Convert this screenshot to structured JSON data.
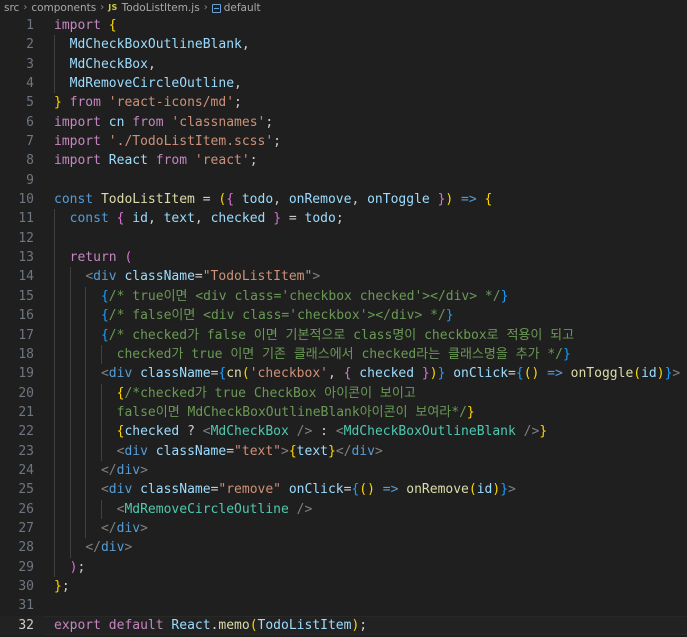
{
  "breadcrumb": {
    "items": [
      "src",
      "components",
      "TodoListItem.js",
      "default"
    ],
    "file_badge": "JS"
  },
  "editor": {
    "active_line": 32,
    "lines": [
      {
        "n": 1,
        "indent": 0,
        "tokens": [
          [
            "k",
            "import"
          ],
          [
            "w",
            " "
          ],
          [
            "b1",
            "{"
          ]
        ]
      },
      {
        "n": 2,
        "indent": 1,
        "tokens": [
          [
            "v",
            "MdCheckBoxOutlineBlank"
          ],
          [
            "w",
            ","
          ]
        ]
      },
      {
        "n": 3,
        "indent": 1,
        "tokens": [
          [
            "v",
            "MdCheckBox"
          ],
          [
            "w",
            ","
          ]
        ]
      },
      {
        "n": 4,
        "indent": 1,
        "tokens": [
          [
            "v",
            "MdRemoveCircleOutline"
          ],
          [
            "w",
            ","
          ]
        ]
      },
      {
        "n": 5,
        "indent": 0,
        "tokens": [
          [
            "b1",
            "}"
          ],
          [
            "w",
            " "
          ],
          [
            "k",
            "from"
          ],
          [
            "w",
            " "
          ],
          [
            "s",
            "'react-icons/md'"
          ],
          [
            "w",
            ";"
          ]
        ]
      },
      {
        "n": 6,
        "indent": 0,
        "tokens": [
          [
            "k",
            "import"
          ],
          [
            "w",
            " "
          ],
          [
            "v",
            "cn"
          ],
          [
            "w",
            " "
          ],
          [
            "k",
            "from"
          ],
          [
            "w",
            " "
          ],
          [
            "s",
            "'classnames'"
          ],
          [
            "w",
            ";"
          ]
        ]
      },
      {
        "n": 7,
        "indent": 0,
        "tokens": [
          [
            "k",
            "import"
          ],
          [
            "w",
            " "
          ],
          [
            "s",
            "'./TodoListItem.scss'"
          ],
          [
            "w",
            ";"
          ]
        ]
      },
      {
        "n": 8,
        "indent": 0,
        "tokens": [
          [
            "k",
            "import"
          ],
          [
            "w",
            " "
          ],
          [
            "v",
            "React"
          ],
          [
            "w",
            " "
          ],
          [
            "k",
            "from"
          ],
          [
            "w",
            " "
          ],
          [
            "s",
            "'react'"
          ],
          [
            "w",
            ";"
          ]
        ]
      },
      {
        "n": 9,
        "indent": 0,
        "tokens": []
      },
      {
        "n": 10,
        "indent": 0,
        "tokens": [
          [
            "d",
            "const"
          ],
          [
            "w",
            " "
          ],
          [
            "f",
            "TodoListItem"
          ],
          [
            "w",
            " = "
          ],
          [
            "b1",
            "("
          ],
          [
            "b2",
            "{"
          ],
          [
            "w",
            " "
          ],
          [
            "v",
            "todo"
          ],
          [
            "w",
            ", "
          ],
          [
            "v",
            "onRemove"
          ],
          [
            "w",
            ", "
          ],
          [
            "v",
            "onToggle"
          ],
          [
            "w",
            " "
          ],
          [
            "b2",
            "}"
          ],
          [
            "b1",
            ")"
          ],
          [
            "w",
            " "
          ],
          [
            "d",
            "=>"
          ],
          [
            "w",
            " "
          ],
          [
            "b1",
            "{"
          ]
        ]
      },
      {
        "n": 11,
        "indent": 1,
        "tokens": [
          [
            "d",
            "const"
          ],
          [
            "w",
            " "
          ],
          [
            "b2",
            "{"
          ],
          [
            "w",
            " "
          ],
          [
            "v",
            "id"
          ],
          [
            "w",
            ", "
          ],
          [
            "v",
            "text"
          ],
          [
            "w",
            ", "
          ],
          [
            "v",
            "checked"
          ],
          [
            "w",
            " "
          ],
          [
            "b2",
            "}"
          ],
          [
            "w",
            " = "
          ],
          [
            "v",
            "todo"
          ],
          [
            "w",
            ";"
          ]
        ]
      },
      {
        "n": 12,
        "indent": 1,
        "tokens": []
      },
      {
        "n": 13,
        "indent": 1,
        "tokens": [
          [
            "k",
            "return"
          ],
          [
            "w",
            " "
          ],
          [
            "b2",
            "("
          ]
        ]
      },
      {
        "n": 14,
        "indent": 2,
        "tokens": [
          [
            "p",
            "<"
          ],
          [
            "t",
            "div"
          ],
          [
            "w",
            " "
          ],
          [
            "at",
            "className"
          ],
          [
            "w",
            "="
          ],
          [
            "s",
            "\"TodoListItem\""
          ],
          [
            "p",
            ">"
          ]
        ]
      },
      {
        "n": 15,
        "indent": 3,
        "tokens": [
          [
            "b3",
            "{"
          ],
          [
            "c",
            "/* true이면 <div class='checkbox checked'></div> */"
          ],
          [
            "b3",
            "}"
          ]
        ]
      },
      {
        "n": 16,
        "indent": 3,
        "tokens": [
          [
            "b3",
            "{"
          ],
          [
            "c",
            "/* false이면 <div class='checkbox'></div> */"
          ],
          [
            "b3",
            "}"
          ]
        ]
      },
      {
        "n": 17,
        "indent": 3,
        "tokens": [
          [
            "b3",
            "{"
          ],
          [
            "c",
            "/* checked가 false 이면 기본적으로 class명이 checkbox로 적용이 되고"
          ]
        ]
      },
      {
        "n": 18,
        "indent": 4,
        "tokens": [
          [
            "c",
            "checked가 true 이면 기존 클래스에서 checked라는 클래스명을 추가 */"
          ],
          [
            "b3",
            "}"
          ]
        ]
      },
      {
        "n": 19,
        "indent": 3,
        "tokens": [
          [
            "p",
            "<"
          ],
          [
            "t",
            "div"
          ],
          [
            "w",
            " "
          ],
          [
            "at",
            "className"
          ],
          [
            "w",
            "="
          ],
          [
            "b3",
            "{"
          ],
          [
            "f",
            "cn"
          ],
          [
            "b1",
            "("
          ],
          [
            "s",
            "'checkbox'"
          ],
          [
            "w",
            ", "
          ],
          [
            "b2",
            "{"
          ],
          [
            "w",
            " "
          ],
          [
            "v",
            "checked"
          ],
          [
            "w",
            " "
          ],
          [
            "b2",
            "}"
          ],
          [
            "b1",
            ")"
          ],
          [
            "b3",
            "}"
          ],
          [
            "w",
            " "
          ],
          [
            "at",
            "onClick"
          ],
          [
            "w",
            "="
          ],
          [
            "b3",
            "{"
          ],
          [
            "b1",
            "()"
          ],
          [
            "w",
            " "
          ],
          [
            "d",
            "=>"
          ],
          [
            "w",
            " "
          ],
          [
            "f",
            "onToggle"
          ],
          [
            "b1",
            "("
          ],
          [
            "v",
            "id"
          ],
          [
            "b1",
            ")"
          ],
          [
            "b3",
            "}"
          ],
          [
            "p",
            ">"
          ]
        ]
      },
      {
        "n": 20,
        "indent": 4,
        "tokens": [
          [
            "b1",
            "{"
          ],
          [
            "c",
            "/*checked가 true CheckBox 아이콘이 보이고"
          ]
        ]
      },
      {
        "n": 21,
        "indent": 4,
        "tokens": [
          [
            "c",
            "false이면 MdCheckBoxOutlineBlank아이콘이 보여라*/"
          ],
          [
            "b1",
            "}"
          ]
        ]
      },
      {
        "n": 22,
        "indent": 4,
        "tokens": [
          [
            "b1",
            "{"
          ],
          [
            "v",
            "checked"
          ],
          [
            "w",
            " ? "
          ],
          [
            "p",
            "<"
          ],
          [
            "tn",
            "MdCheckBox"
          ],
          [
            "w",
            " "
          ],
          [
            "p",
            "/>"
          ],
          [
            "w",
            " : "
          ],
          [
            "p",
            "<"
          ],
          [
            "tn",
            "MdCheckBoxOutlineBlank"
          ],
          [
            "w",
            " "
          ],
          [
            "p",
            "/>"
          ],
          [
            "b1",
            "}"
          ]
        ]
      },
      {
        "n": 23,
        "indent": 4,
        "tokens": [
          [
            "p",
            "<"
          ],
          [
            "t",
            "div"
          ],
          [
            "w",
            " "
          ],
          [
            "at",
            "className"
          ],
          [
            "w",
            "="
          ],
          [
            "s",
            "\"text\""
          ],
          [
            "p",
            ">"
          ],
          [
            "b1",
            "{"
          ],
          [
            "v",
            "text"
          ],
          [
            "b1",
            "}"
          ],
          [
            "p",
            "</"
          ],
          [
            "t",
            "div"
          ],
          [
            "p",
            ">"
          ]
        ]
      },
      {
        "n": 24,
        "indent": 3,
        "tokens": [
          [
            "p",
            "</"
          ],
          [
            "t",
            "div"
          ],
          [
            "p",
            ">"
          ]
        ]
      },
      {
        "n": 25,
        "indent": 3,
        "tokens": [
          [
            "p",
            "<"
          ],
          [
            "t",
            "div"
          ],
          [
            "w",
            " "
          ],
          [
            "at",
            "className"
          ],
          [
            "w",
            "="
          ],
          [
            "s",
            "\"remove\""
          ],
          [
            "w",
            " "
          ],
          [
            "at",
            "onClick"
          ],
          [
            "w",
            "="
          ],
          [
            "b3",
            "{"
          ],
          [
            "b1",
            "()"
          ],
          [
            "w",
            " "
          ],
          [
            "d",
            "=>"
          ],
          [
            "w",
            " "
          ],
          [
            "f",
            "onRemove"
          ],
          [
            "b1",
            "("
          ],
          [
            "v",
            "id"
          ],
          [
            "b1",
            ")"
          ],
          [
            "b3",
            "}"
          ],
          [
            "p",
            ">"
          ]
        ]
      },
      {
        "n": 26,
        "indent": 4,
        "tokens": [
          [
            "p",
            "<"
          ],
          [
            "tn",
            "MdRemoveCircleOutline"
          ],
          [
            "w",
            " "
          ],
          [
            "p",
            "/>"
          ]
        ]
      },
      {
        "n": 27,
        "indent": 3,
        "tokens": [
          [
            "p",
            "</"
          ],
          [
            "t",
            "div"
          ],
          [
            "p",
            ">"
          ]
        ]
      },
      {
        "n": 28,
        "indent": 2,
        "tokens": [
          [
            "p",
            "</"
          ],
          [
            "t",
            "div"
          ],
          [
            "p",
            ">"
          ]
        ]
      },
      {
        "n": 29,
        "indent": 1,
        "tokens": [
          [
            "b2",
            ")"
          ],
          [
            "w",
            ";"
          ]
        ]
      },
      {
        "n": 30,
        "indent": 0,
        "tokens": [
          [
            "b1",
            "}"
          ],
          [
            "w",
            ";"
          ]
        ]
      },
      {
        "n": 31,
        "indent": 0,
        "tokens": []
      },
      {
        "n": 32,
        "indent": 0,
        "tokens": [
          [
            "k",
            "export"
          ],
          [
            "w",
            " "
          ],
          [
            "k",
            "default"
          ],
          [
            "w",
            " "
          ],
          [
            "v",
            "React"
          ],
          [
            "w",
            "."
          ],
          [
            "f",
            "memo"
          ],
          [
            "b1",
            "("
          ],
          [
            "v",
            "TodoListItem"
          ],
          [
            "b1",
            ")"
          ],
          [
            "w",
            ";"
          ]
        ]
      }
    ]
  }
}
